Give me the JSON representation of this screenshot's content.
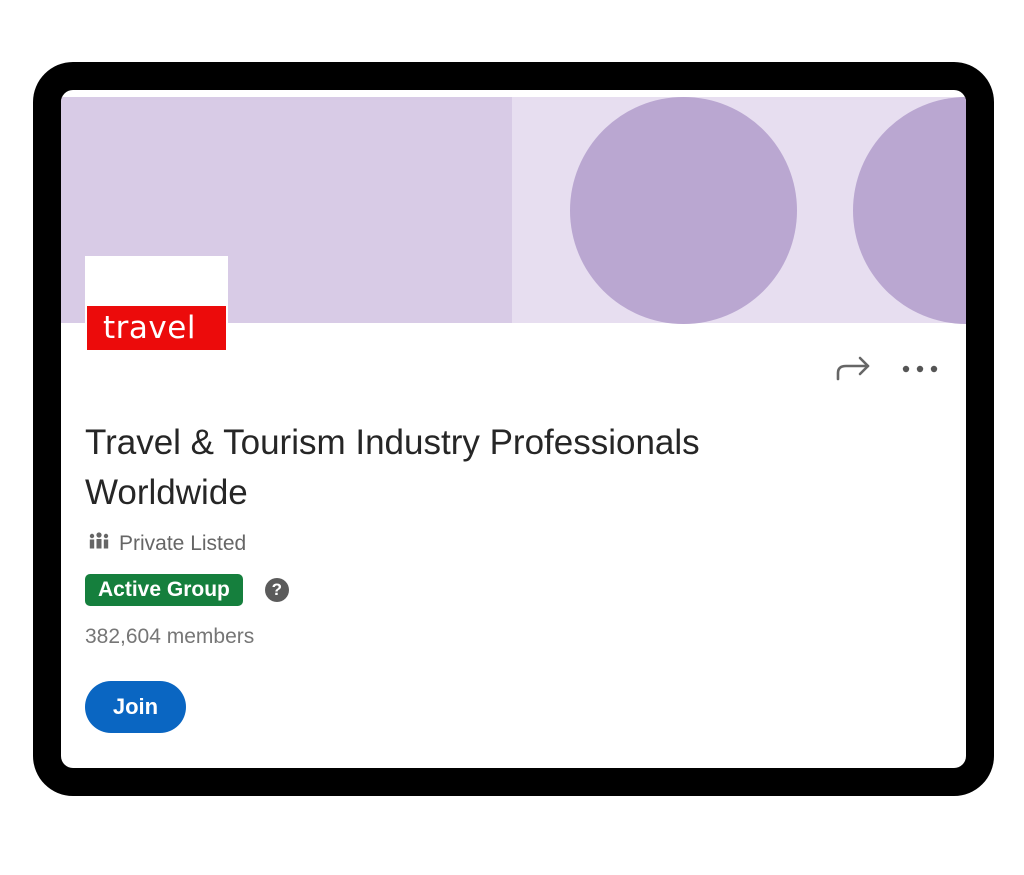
{
  "group": {
    "logo_text": "travel",
    "title": "Travel & Tourism Industry Professionals Worldwide",
    "privacy_label": "Private Listed",
    "badge_label": "Active Group",
    "help_glyph": "?",
    "members_text": "382,604 members",
    "join_label": "Join"
  },
  "icons": {
    "share": "share-icon",
    "more": "more-options-icon",
    "privacy": "people-group-icon",
    "help": "help-circle-icon"
  },
  "colors": {
    "banner_left": "#d8cbe6",
    "banner_right": "#e7def0",
    "banner_circles": "#baa7d1",
    "logo_red": "#ec0b0b",
    "active_badge": "#157f3d",
    "join_button": "#0a66c2",
    "title_text": "#262626"
  }
}
